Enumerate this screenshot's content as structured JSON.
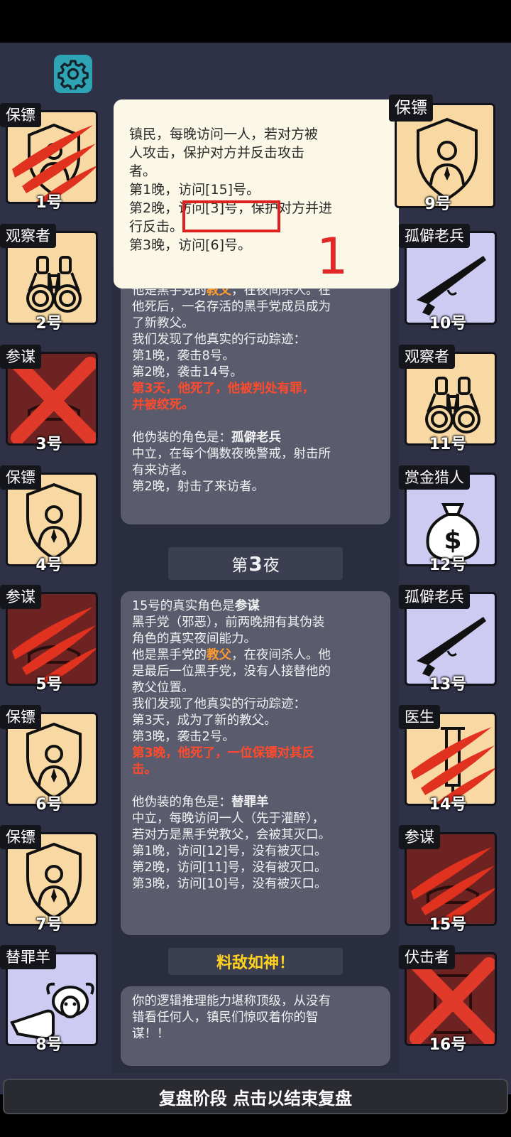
{
  "popup": {
    "lines": [
      "镇民，每晚访问一人，若对方被",
      "人攻击，保护对方并反击攻击",
      "者。",
      "第1晚，访问[15]号。",
      "第2晚，访问[3]号，保护对方并进",
      "行反击。",
      "第3晚，访问[6]号。"
    ],
    "annotation": "1"
  },
  "log": {
    "card1_lines": [
      "他是黑手党的",
      "教父",
      "，在夜间杀人。在",
      "他死后，一名存活的黑手党成员成为",
      "了新教父。",
      "我们发现了他真实的行动踪迹：",
      "第1晚，袭击8号。",
      "第2晚，袭击14号。",
      "第3天，他死了，他被判处有罪，",
      "并被绞死。",
      "他伪装的角色是：",
      "孤僻老兵",
      "中立，在每个偶数夜晚警戒，射击所",
      "有来访者。",
      "第2晚，射击了来访者。"
    ],
    "night_prefix": "第",
    "night_number": "3",
    "night_suffix": "夜",
    "card2_lines": [
      "15号的真实角色是",
      "参谋",
      "黑手党（邪恶），前两晚拥有其伪装",
      "角色的真实夜间能力。",
      "他是黑手党的",
      "教父",
      "，在夜间杀人。他",
      "是最后一位黑手党，没有人接替他的",
      "教父位置。",
      "我们发现了他真实的行动踪迹：",
      "第3天，成为了新的教父。",
      "第3晚，袭击2号。",
      "第3晚，他死了，一位保镖对其反",
      "击。",
      "他伪装的角色是：",
      "替罪羊",
      "中立，每晚访问一人（先于灌醉），",
      "若对方是黑手党教父，会被其灭口。",
      "第1晚，访问[12]号，没有被灭口。",
      "第2晚，访问[11]号，没有被灭口。",
      "第3晚，访问[10]号，没有被灭口。"
    ],
    "praise_title": "料敌如神！",
    "card3_lines": [
      "你的逻辑推理能力堪称顶级，从没有",
      "错看任何人，镇民们惊叹着你的智",
      "谋！！"
    ]
  },
  "players_left": [
    {
      "role": "保镖",
      "num": "1号",
      "icon": "bodyguard-shield-icon",
      "state": "clawed"
    },
    {
      "role": "观察者",
      "num": "2号",
      "icon": "binoculars-icon",
      "state": "alive"
    },
    {
      "role": "参谋",
      "num": "3号",
      "icon": "crossed-out-icon",
      "state": "executed"
    },
    {
      "role": "保镖",
      "num": "4号",
      "icon": "bodyguard-shield-icon",
      "state": "alive"
    },
    {
      "role": "参谋",
      "num": "5号",
      "icon": "clawed-mafia-icon",
      "state": "clawed"
    },
    {
      "role": "保镖",
      "num": "6号",
      "icon": "bodyguard-shield-icon",
      "state": "alive"
    },
    {
      "role": "保镖",
      "num": "7号",
      "icon": "bodyguard-shield-icon",
      "state": "alive"
    },
    {
      "role": "替罪羊",
      "num": "8号",
      "icon": "scapegoat-sheep-icon",
      "state": "alive"
    }
  ],
  "players_right": [
    {
      "role": "保镖",
      "num": "9号",
      "icon": "bodyguard-shield-icon",
      "state": "self"
    },
    {
      "role": "孤僻老兵",
      "num": "10号",
      "icon": "rifle-icon",
      "state": "alive"
    },
    {
      "role": "观察者",
      "num": "11号",
      "icon": "binoculars-icon",
      "state": "alive"
    },
    {
      "role": "赏金猎人",
      "num": "12号",
      "icon": "money-bag-icon",
      "state": "alive"
    },
    {
      "role": "孤僻老兵",
      "num": "13号",
      "icon": "rifle-icon",
      "state": "alive"
    },
    {
      "role": "医生",
      "num": "14号",
      "icon": "syringe-icon",
      "state": "clawed"
    },
    {
      "role": "参谋",
      "num": "15号",
      "icon": "clawed-mafia-icon",
      "state": "clawed"
    },
    {
      "role": "伏击者",
      "num": "16号",
      "icon": "crossed-out-icon",
      "state": "executed"
    }
  ],
  "footer": {
    "label": "复盘阶段 点击以结束复盘"
  },
  "colors": {
    "background": "#2f3147",
    "card_tan": "#f8d9a3",
    "card_lavender": "#cecbf2",
    "card_maroon": "#6e2323",
    "claw_red": "#e0321e",
    "highlight_orange": "#ff9a2e",
    "highlight_red": "#ff4a2c",
    "praise_yellow": "#ffd21e"
  }
}
